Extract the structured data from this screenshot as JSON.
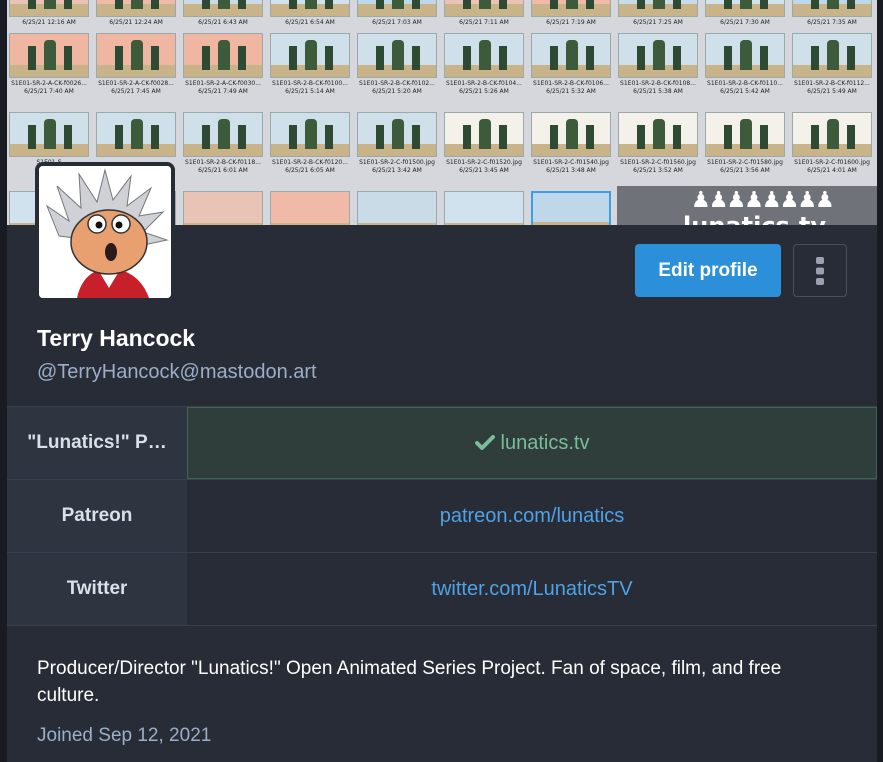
{
  "profile": {
    "display_name": "Terry Hancock",
    "handle": "@TerryHancock@mastodon.art",
    "bio": "Producer/Director \"Lunatics!\" Open Animated Series Project. Fan of space, film, and free culture.",
    "joined_label": "Joined",
    "joined_date": "Sep 12, 2021"
  },
  "actions": {
    "edit_profile": "Edit profile"
  },
  "fields": [
    {
      "name": "\"Lunatics!\" P…",
      "value": "lunatics.tv",
      "verified": true
    },
    {
      "name": "Patreon",
      "value": "patreon.com/lunatics",
      "verified": false
    },
    {
      "name": "Twitter",
      "value": "twitter.com/LunaticsTV",
      "verified": false
    }
  ],
  "header": {
    "logo_text": "lunatics.tv",
    "rows": [
      {
        "captions": [
          [
            "",
            "6/25/21 12:16 AM"
          ],
          [
            "",
            "6/25/21 12:24 AM"
          ],
          [
            "",
            "6/25/21 6:43 AM"
          ],
          [
            "",
            "6/25/21 6:54 AM"
          ],
          [
            "",
            "6/25/21 7:03 AM"
          ],
          [
            "",
            "6/25/21 7:11 AM"
          ],
          [
            "",
            "6/25/21 7:19 AM"
          ],
          [
            "",
            "6/25/21 7:25 AM"
          ],
          [
            "",
            "6/25/21 7:30 AM"
          ],
          [
            "",
            "6/25/21 7:35 AM"
          ]
        ]
      },
      {
        "captions": [
          [
            "S1E01-SR-2-A-CK-f0026...",
            "6/25/21 7:40 AM"
          ],
          [
            "S1E01-SR-2-A-CK-f0028...",
            "6/25/21 7:45 AM"
          ],
          [
            "S1E01-SR-2-A-CK-f0030...",
            "6/25/21 7:49 AM"
          ],
          [
            "S1E01-SR-2-B-CK-f0100...",
            "6/25/21 5:14 AM"
          ],
          [
            "S1E01-SR-2-B-CK-f0102...",
            "6/25/21 5:20 AM"
          ],
          [
            "S1E01-SR-2-B-CK-f0104...",
            "6/25/21 5:26 AM"
          ],
          [
            "S1E01-SR-2-B-CK-f0106...",
            "6/25/21 5:32 AM"
          ],
          [
            "S1E01-SR-2-B-CK-f0108...",
            "6/25/21 5:38 AM"
          ],
          [
            "S1E01-SR-2-B-CK-f0110...",
            "6/25/21 5:42 AM"
          ],
          [
            "S1E01-SR-2-B-CK-f0112...",
            "6/25/21 5:49 AM"
          ]
        ]
      },
      {
        "captions": [
          [
            "S1E01-S",
            "6/2"
          ],
          [
            "",
            ""
          ],
          [
            "S1E01-SR-2-B-CK-f0118...",
            "6/25/21 6:01 AM"
          ],
          [
            "S1E01-SR-2-B-CK-f0120...",
            "6/25/21 6:05 AM"
          ],
          [
            "S1E01-SR-2-C-f01500.jpg",
            "6/25/21 3:42 AM"
          ],
          [
            "S1E01-SR-2-C-f01520.jpg",
            "6/25/21 3:45 AM"
          ],
          [
            "S1E01-SR-2-C-f01540.jpg",
            "6/25/21 3:48 AM"
          ],
          [
            "S1E01-SR-2-C-f01560.jpg",
            "6/25/21 3:52 AM"
          ],
          [
            "S1E01-SR-2-C-f01580.jpg",
            "6/25/21 3:56 AM"
          ],
          [
            "S1E01-SR-2-C-f01600.jpg",
            "6/25/21 4:01 AM"
          ]
        ]
      }
    ]
  },
  "colors": {
    "accent": "#2b90d9",
    "verified": "#79bd9a",
    "link": "#4ea2e5",
    "muted": "#9baec8"
  }
}
